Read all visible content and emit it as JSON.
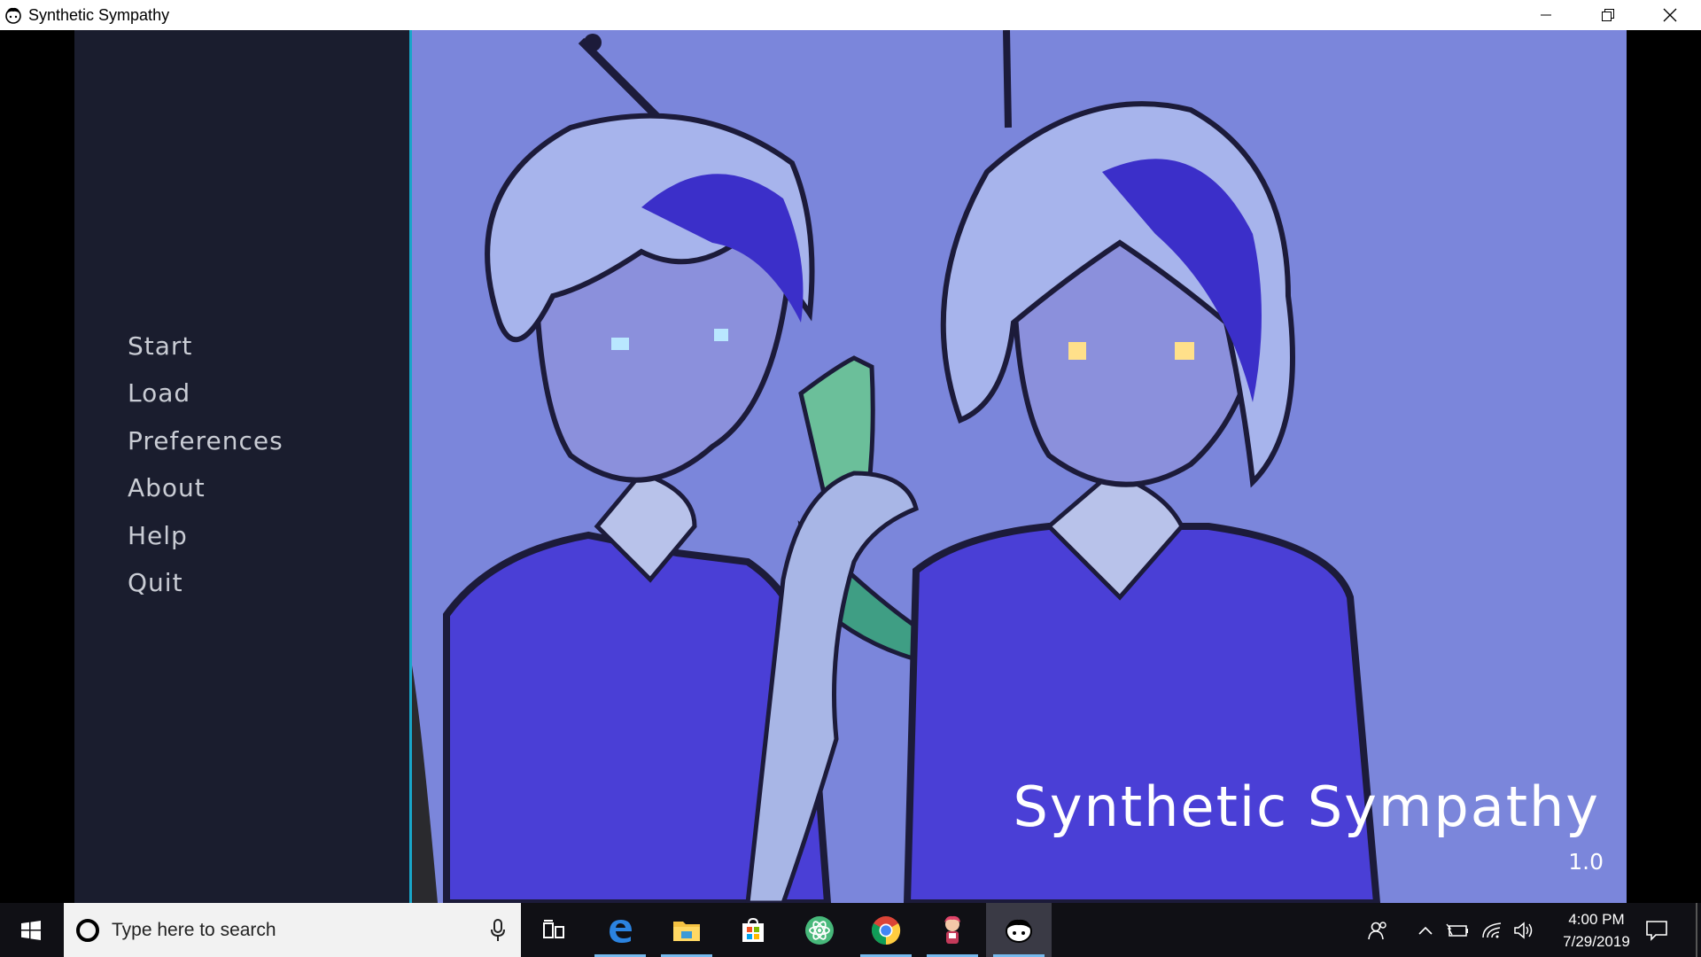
{
  "window": {
    "title": "Synthetic Sympathy",
    "icon": "app-face-icon",
    "controls": [
      "minimize-icon",
      "restore-icon",
      "close-icon"
    ]
  },
  "game": {
    "menu": {
      "items": [
        {
          "label": "Start"
        },
        {
          "label": "Load"
        },
        {
          "label": "Preferences"
        },
        {
          "label": "About"
        },
        {
          "label": "Help"
        },
        {
          "label": "Quit"
        }
      ]
    },
    "title": "Synthetic Sympathy",
    "version": "1.0",
    "colors": {
      "menu_panel": "#1a1d2e",
      "divider_accent": "#19a6c8",
      "background_art": "#7b86db",
      "menu_text": "#c9ccd4"
    }
  },
  "taskbar": {
    "start_icon": "windows-logo-icon",
    "search": {
      "placeholder": "Type here to search",
      "mic_icon": "microphone-icon"
    },
    "pinned": [
      {
        "name": "task-view-icon"
      },
      {
        "name": "edge-icon"
      },
      {
        "name": "file-explorer-icon"
      },
      {
        "name": "store-icon"
      },
      {
        "name": "atom-icon"
      },
      {
        "name": "chrome-icon"
      },
      {
        "name": "renpy-icon"
      },
      {
        "name": "synthetic-sympathy-icon",
        "active": true
      }
    ],
    "tray_icons": [
      "people-icon",
      "chevron-up-icon",
      "battery-icon",
      "wifi-icon",
      "volume-icon"
    ],
    "clock": {
      "time": "4:00 PM",
      "date": "7/29/2019"
    },
    "notification_icon": "action-center-icon"
  }
}
